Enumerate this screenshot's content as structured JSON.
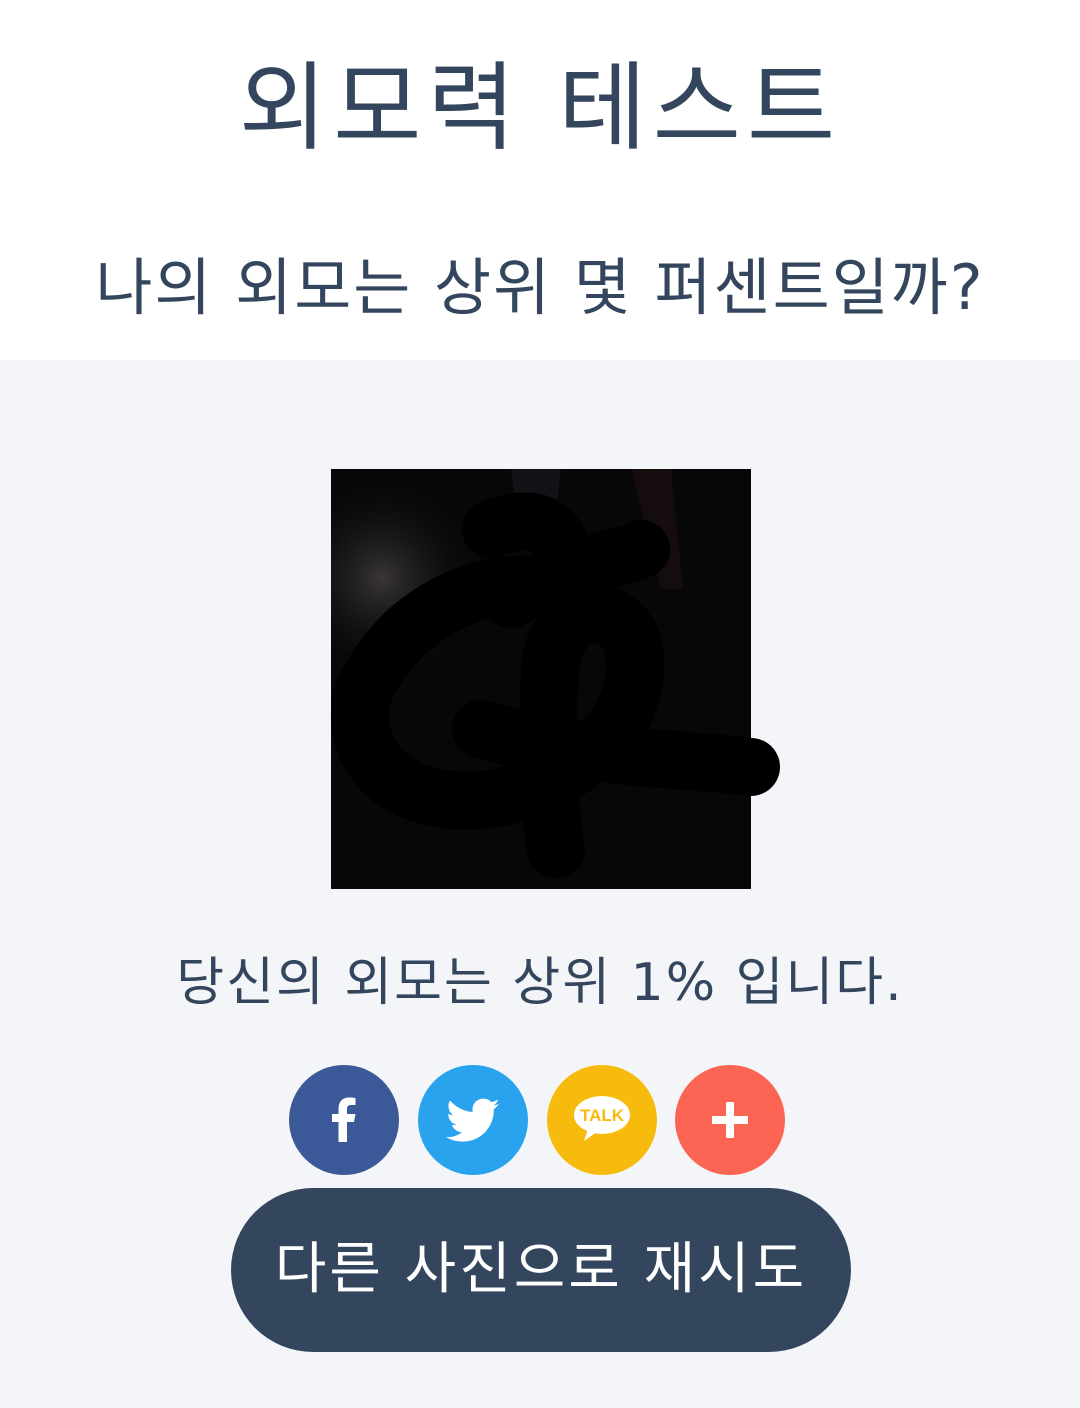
{
  "header": {
    "title": "외모력 테스트",
    "subtitle": "나의 외모는 상위 몇 퍼센트일까?"
  },
  "result": {
    "photo_alt": "uploaded photo (scribbled over)",
    "text": "당신의 외모는 상위 1% 입니다."
  },
  "share": {
    "buttons": [
      {
        "name": "facebook",
        "icon": "facebook-icon",
        "color": "#3b5998"
      },
      {
        "name": "twitter",
        "icon": "twitter-icon",
        "color": "#2aa3ef"
      },
      {
        "name": "kakaotalk",
        "icon": "kakaotalk-icon",
        "label": "TALK",
        "color": "#f7bb0e"
      },
      {
        "name": "more",
        "icon": "plus-icon",
        "color": "#fc6554"
      }
    ]
  },
  "actions": {
    "retry_label": "다른 사진으로 재시도"
  },
  "colors": {
    "text_primary": "#34465d",
    "background": "#f4f5f9",
    "button": "#34465d"
  }
}
